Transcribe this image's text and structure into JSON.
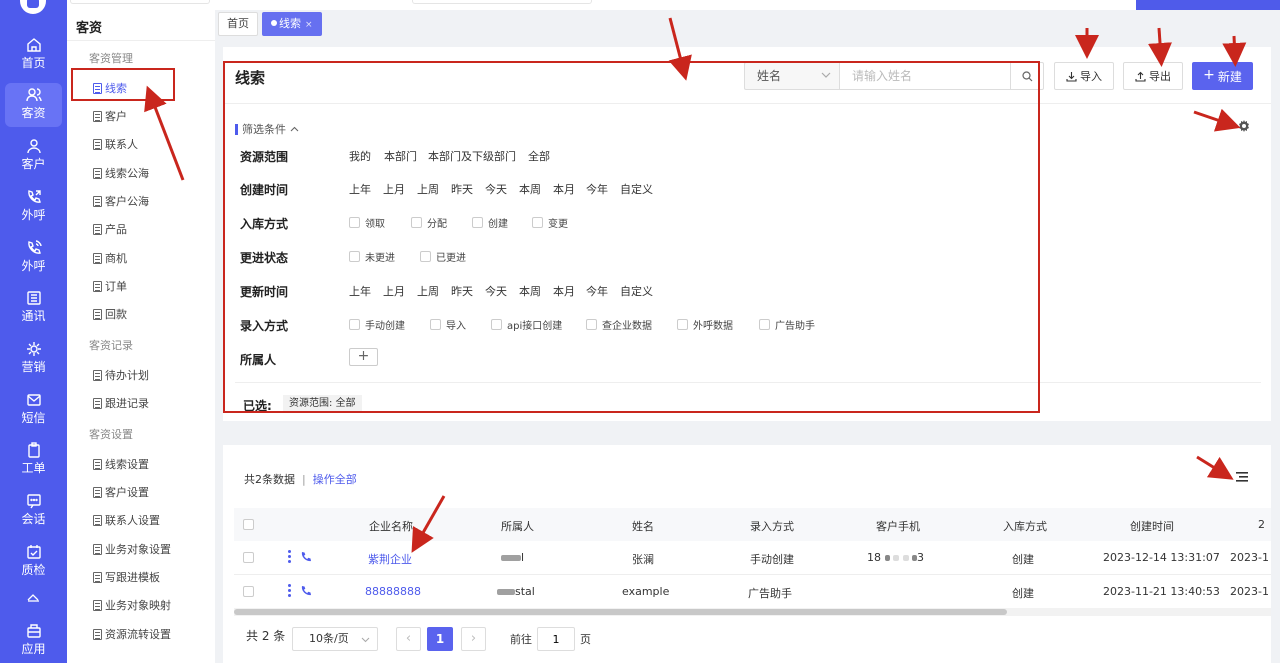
{
  "rail": {
    "items": [
      {
        "label": "首页",
        "icon": "home-icon"
      },
      {
        "label": "客资",
        "icon": "users-icon",
        "active": true
      },
      {
        "label": "客户",
        "icon": "user-icon"
      },
      {
        "label": "外呼",
        "icon": "phone-out-icon"
      },
      {
        "label": "外呼",
        "icon": "phone-call-icon"
      },
      {
        "label": "通讯",
        "icon": "contacts-icon"
      },
      {
        "label": "营销",
        "icon": "marketing-icon"
      },
      {
        "label": "短信",
        "icon": "sms-icon"
      },
      {
        "label": "工单",
        "icon": "clipboard-icon"
      },
      {
        "label": "会话",
        "icon": "chat-icon"
      },
      {
        "label": "质检",
        "icon": "quality-icon"
      },
      {
        "label": "应用",
        "icon": "apps-icon"
      }
    ]
  },
  "sidebar": {
    "title": "客资",
    "groups": [
      {
        "title": "客资管理",
        "items": [
          "线索",
          "客户",
          "联系人",
          "线索公海",
          "客户公海",
          "产品",
          "商机",
          "订单",
          "回款"
        ]
      },
      {
        "title": "客资记录",
        "items": [
          "待办计划",
          "跟进记录"
        ]
      },
      {
        "title": "客资设置",
        "items": [
          "线索设置",
          "客户设置",
          "联系人设置",
          "业务对象设置",
          "写跟进模板",
          "业务对象映射",
          "资源流转设置"
        ]
      }
    ],
    "active_item": "线索"
  },
  "tabs": [
    {
      "label": "首页"
    },
    {
      "label": "线索",
      "close": "×"
    }
  ],
  "header": {
    "title": "线索",
    "search_field": "姓名",
    "search_placeholder": "请输入姓名",
    "import_label": "导入",
    "export_label": "导出",
    "new_label": "新建"
  },
  "filters": {
    "toggle_label": "筛选条件",
    "resource_range": {
      "label": "资源范围",
      "options": [
        "我的",
        "本部门",
        "本部门及下级部门",
        "全部"
      ]
    },
    "created_time": {
      "label": "创建时间",
      "options": [
        "上年",
        "上月",
        "上周",
        "昨天",
        "今天",
        "本周",
        "本月",
        "今年",
        "自定义"
      ]
    },
    "storage_method": {
      "label": "入库方式",
      "options": [
        "领取",
        "分配",
        "创建",
        "变更"
      ]
    },
    "follow_status": {
      "label": "更进状态",
      "options": [
        "未更进",
        "已更进"
      ]
    },
    "updated_time": {
      "label": "更新时间",
      "options": [
        "上年",
        "上月",
        "上周",
        "昨天",
        "今天",
        "本周",
        "本月",
        "今年",
        "自定义"
      ]
    },
    "entry_method": {
      "label": "录入方式",
      "options": [
        "手动创建",
        "导入",
        "api接口创建",
        "查企业数据",
        "外呼数据",
        "广告助手"
      ]
    },
    "owner": {
      "label": "所属人",
      "add": "+"
    },
    "selected_label": "已选:",
    "selected_tag": "资源范围: 全部"
  },
  "table": {
    "total_text": "共2条数据",
    "separator": "|",
    "operate_all": "操作全部",
    "columns": [
      "企业名称",
      "所属人",
      "姓名",
      "录入方式",
      "客户手机",
      "入库方式",
      "创建时间",
      "2"
    ],
    "rows": [
      {
        "company": "紫荆企业",
        "owner": "l",
        "name": "张澜",
        "entry": "手动创建",
        "phone_prefix": "18",
        "phone_suffix": "3",
        "storage": "创建",
        "created": "2023-12-14 13:31:07",
        "extra": "2023-1"
      },
      {
        "company": "88888888",
        "owner": "stal",
        "name": "example",
        "entry": "广告助手",
        "phone_prefix": "",
        "phone_suffix": "",
        "storage": "创建",
        "created": "2023-11-21 13:40:53",
        "extra": "2023-1"
      }
    ]
  },
  "pagination": {
    "total": "共 2 条",
    "page_size": "10条/页",
    "prev": "‹",
    "current": "1",
    "next": "›",
    "goto_label": "前往",
    "goto_value": "1",
    "page_unit": "页"
  },
  "colors": {
    "accent": "#4e5bec",
    "annotation": "#c9261d"
  }
}
